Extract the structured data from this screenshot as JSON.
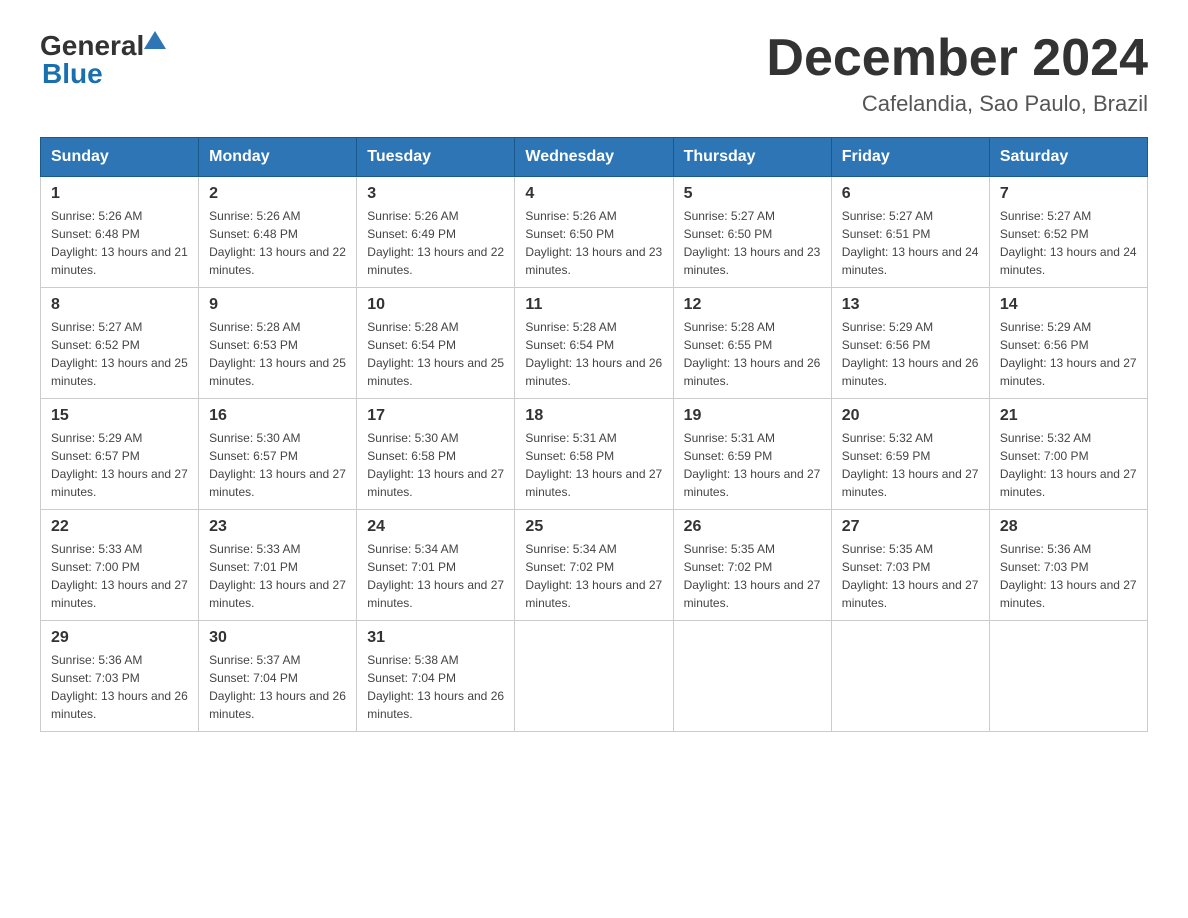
{
  "header": {
    "logo": {
      "general": "General",
      "blue": "Blue"
    },
    "month_title": "December 2024",
    "location": "Cafelandia, Sao Paulo, Brazil"
  },
  "weekdays": [
    "Sunday",
    "Monday",
    "Tuesday",
    "Wednesday",
    "Thursday",
    "Friday",
    "Saturday"
  ],
  "weeks": [
    [
      {
        "day": "1",
        "sunrise": "5:26 AM",
        "sunset": "6:48 PM",
        "daylight": "13 hours and 21 minutes."
      },
      {
        "day": "2",
        "sunrise": "5:26 AM",
        "sunset": "6:48 PM",
        "daylight": "13 hours and 22 minutes."
      },
      {
        "day": "3",
        "sunrise": "5:26 AM",
        "sunset": "6:49 PM",
        "daylight": "13 hours and 22 minutes."
      },
      {
        "day": "4",
        "sunrise": "5:26 AM",
        "sunset": "6:50 PM",
        "daylight": "13 hours and 23 minutes."
      },
      {
        "day": "5",
        "sunrise": "5:27 AM",
        "sunset": "6:50 PM",
        "daylight": "13 hours and 23 minutes."
      },
      {
        "day": "6",
        "sunrise": "5:27 AM",
        "sunset": "6:51 PM",
        "daylight": "13 hours and 24 minutes."
      },
      {
        "day": "7",
        "sunrise": "5:27 AM",
        "sunset": "6:52 PM",
        "daylight": "13 hours and 24 minutes."
      }
    ],
    [
      {
        "day": "8",
        "sunrise": "5:27 AM",
        "sunset": "6:52 PM",
        "daylight": "13 hours and 25 minutes."
      },
      {
        "day": "9",
        "sunrise": "5:28 AM",
        "sunset": "6:53 PM",
        "daylight": "13 hours and 25 minutes."
      },
      {
        "day": "10",
        "sunrise": "5:28 AM",
        "sunset": "6:54 PM",
        "daylight": "13 hours and 25 minutes."
      },
      {
        "day": "11",
        "sunrise": "5:28 AM",
        "sunset": "6:54 PM",
        "daylight": "13 hours and 26 minutes."
      },
      {
        "day": "12",
        "sunrise": "5:28 AM",
        "sunset": "6:55 PM",
        "daylight": "13 hours and 26 minutes."
      },
      {
        "day": "13",
        "sunrise": "5:29 AM",
        "sunset": "6:56 PM",
        "daylight": "13 hours and 26 minutes."
      },
      {
        "day": "14",
        "sunrise": "5:29 AM",
        "sunset": "6:56 PM",
        "daylight": "13 hours and 27 minutes."
      }
    ],
    [
      {
        "day": "15",
        "sunrise": "5:29 AM",
        "sunset": "6:57 PM",
        "daylight": "13 hours and 27 minutes."
      },
      {
        "day": "16",
        "sunrise": "5:30 AM",
        "sunset": "6:57 PM",
        "daylight": "13 hours and 27 minutes."
      },
      {
        "day": "17",
        "sunrise": "5:30 AM",
        "sunset": "6:58 PM",
        "daylight": "13 hours and 27 minutes."
      },
      {
        "day": "18",
        "sunrise": "5:31 AM",
        "sunset": "6:58 PM",
        "daylight": "13 hours and 27 minutes."
      },
      {
        "day": "19",
        "sunrise": "5:31 AM",
        "sunset": "6:59 PM",
        "daylight": "13 hours and 27 minutes."
      },
      {
        "day": "20",
        "sunrise": "5:32 AM",
        "sunset": "6:59 PM",
        "daylight": "13 hours and 27 minutes."
      },
      {
        "day": "21",
        "sunrise": "5:32 AM",
        "sunset": "7:00 PM",
        "daylight": "13 hours and 27 minutes."
      }
    ],
    [
      {
        "day": "22",
        "sunrise": "5:33 AM",
        "sunset": "7:00 PM",
        "daylight": "13 hours and 27 minutes."
      },
      {
        "day": "23",
        "sunrise": "5:33 AM",
        "sunset": "7:01 PM",
        "daylight": "13 hours and 27 minutes."
      },
      {
        "day": "24",
        "sunrise": "5:34 AM",
        "sunset": "7:01 PM",
        "daylight": "13 hours and 27 minutes."
      },
      {
        "day": "25",
        "sunrise": "5:34 AM",
        "sunset": "7:02 PM",
        "daylight": "13 hours and 27 minutes."
      },
      {
        "day": "26",
        "sunrise": "5:35 AM",
        "sunset": "7:02 PM",
        "daylight": "13 hours and 27 minutes."
      },
      {
        "day": "27",
        "sunrise": "5:35 AM",
        "sunset": "7:03 PM",
        "daylight": "13 hours and 27 minutes."
      },
      {
        "day": "28",
        "sunrise": "5:36 AM",
        "sunset": "7:03 PM",
        "daylight": "13 hours and 27 minutes."
      }
    ],
    [
      {
        "day": "29",
        "sunrise": "5:36 AM",
        "sunset": "7:03 PM",
        "daylight": "13 hours and 26 minutes."
      },
      {
        "day": "30",
        "sunrise": "5:37 AM",
        "sunset": "7:04 PM",
        "daylight": "13 hours and 26 minutes."
      },
      {
        "day": "31",
        "sunrise": "5:38 AM",
        "sunset": "7:04 PM",
        "daylight": "13 hours and 26 minutes."
      },
      null,
      null,
      null,
      null
    ]
  ],
  "labels": {
    "sunrise_prefix": "Sunrise: ",
    "sunset_prefix": "Sunset: ",
    "daylight_prefix": "Daylight: "
  }
}
